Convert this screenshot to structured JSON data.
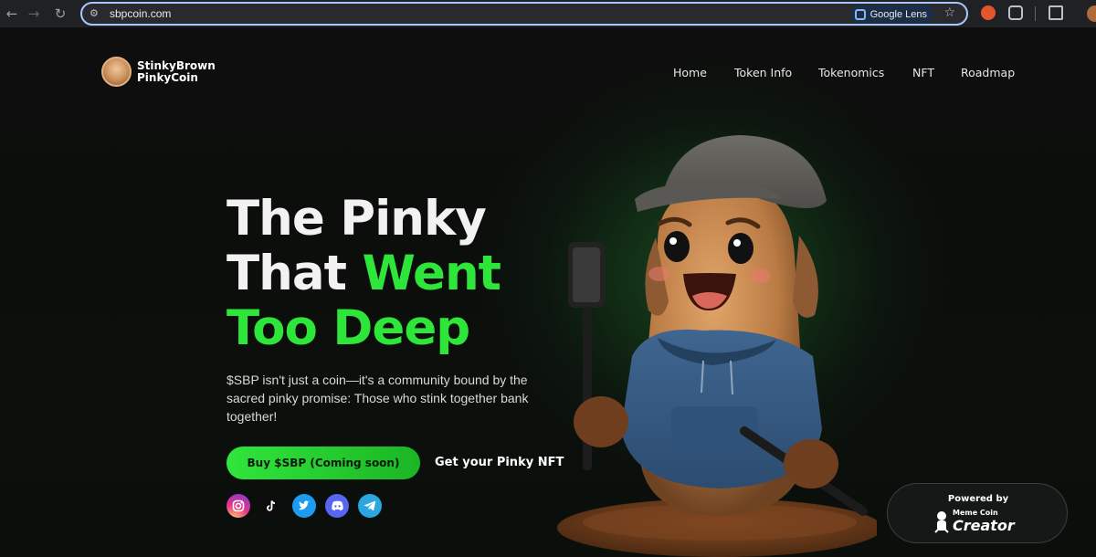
{
  "browser": {
    "url": "sbpcoin.com",
    "lens_label": "Google Lens"
  },
  "brand": {
    "line1": "StinkyBrown",
    "line2": "PinkyCoin"
  },
  "nav": [
    "Home",
    "Token Info",
    "Tokenomics",
    "NFT",
    "Roadmap"
  ],
  "hero": {
    "line1": "The Pinky",
    "line2_white": "That ",
    "line2_green": "Went",
    "line3": "Too Deep",
    "description": "$SBP isn't just a coin—it's a community bound by the sacred pinky promise: Those who stink together bank together!",
    "buy_button": "Buy $SBP (Coming soon)",
    "nft_link": "Get your Pinky NFT"
  },
  "socials": [
    "instagram-icon",
    "tiktok-icon",
    "twitter-icon",
    "discord-icon",
    "telegram-icon"
  ],
  "badge": {
    "powered_by": "Powered by",
    "name_small": "Meme Coin",
    "name_big": "Creator"
  },
  "colors": {
    "accent_green": "#2ee53a",
    "background": "#0b0d0b"
  }
}
